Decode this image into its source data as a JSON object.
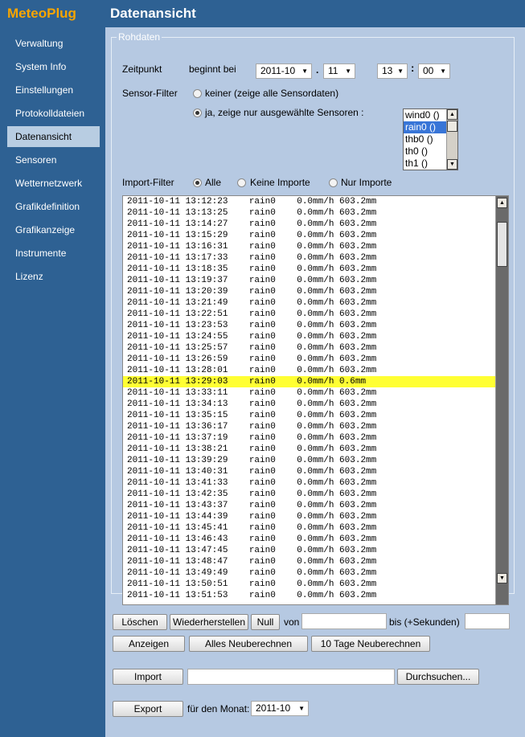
{
  "app": {
    "logo": "MeteoPlug",
    "page_title": "Datenansicht"
  },
  "sidebar": {
    "items": [
      {
        "label": "Verwaltung"
      },
      {
        "label": "System Info"
      },
      {
        "label": "Einstellungen"
      },
      {
        "label": "Protokolldateien"
      },
      {
        "label": "Datenansicht",
        "active": true
      },
      {
        "label": "Sensoren"
      },
      {
        "label": "Wetternetzwerk"
      },
      {
        "label": "Grafikdefinition"
      },
      {
        "label": "Grafikanzeige"
      },
      {
        "label": "Instrumente"
      },
      {
        "label": "Lizenz"
      }
    ]
  },
  "rohdaten": {
    "legend": "Rohdaten",
    "zeitpunkt": {
      "label": "Zeitpunkt",
      "begins_label": "beginnt bei",
      "month": "2011-10",
      "sep1": ".",
      "day": "11",
      "hour": "13",
      "sep2": ":",
      "minute": "00"
    },
    "sensor_filter": {
      "label": "Sensor-Filter",
      "option_none": "keiner (zeige alle Sensordaten)",
      "option_selected": "ja, zeige nur ausgewählte Sensoren :",
      "selected": "option_selected",
      "sensors": [
        "wind0 ()",
        "rain0 ()",
        "thb0 ()",
        "th0 ()",
        "th1 ()"
      ],
      "highlighted_sensor": "rain0 ()"
    },
    "import_filter": {
      "label": "Import-Filter",
      "options": [
        "Alle",
        "Keine Importe",
        "Nur Importe"
      ],
      "selected": "Alle"
    },
    "log_rows": [
      "2011-10-11 13:12:23    rain0    0.0mm/h 603.2mm",
      "2011-10-11 13:13:25    rain0    0.0mm/h 603.2mm",
      "2011-10-11 13:14:27    rain0    0.0mm/h 603.2mm",
      "2011-10-11 13:15:29    rain0    0.0mm/h 603.2mm",
      "2011-10-11 13:16:31    rain0    0.0mm/h 603.2mm",
      "2011-10-11 13:17:33    rain0    0.0mm/h 603.2mm",
      "2011-10-11 13:18:35    rain0    0.0mm/h 603.2mm",
      "2011-10-11 13:19:37    rain0    0.0mm/h 603.2mm",
      "2011-10-11 13:20:39    rain0    0.0mm/h 603.2mm",
      "2011-10-11 13:21:49    rain0    0.0mm/h 603.2mm",
      "2011-10-11 13:22:51    rain0    0.0mm/h 603.2mm",
      "2011-10-11 13:23:53    rain0    0.0mm/h 603.2mm",
      "2011-10-11 13:24:55    rain0    0.0mm/h 603.2mm",
      "2011-10-11 13:25:57    rain0    0.0mm/h 603.2mm",
      "2011-10-11 13:26:59    rain0    0.0mm/h 603.2mm",
      "2011-10-11 13:28:01    rain0    0.0mm/h 603.2mm",
      "2011-10-11 13:29:03    rain0    0.0mm/h 0.6mm",
      "2011-10-11 13:33:11    rain0    0.0mm/h 603.2mm",
      "2011-10-11 13:34:13    rain0    0.0mm/h 603.2mm",
      "2011-10-11 13:35:15    rain0    0.0mm/h 603.2mm",
      "2011-10-11 13:36:17    rain0    0.0mm/h 603.2mm",
      "2011-10-11 13:37:19    rain0    0.0mm/h 603.2mm",
      "2011-10-11 13:38:21    rain0    0.0mm/h 603.2mm",
      "2011-10-11 13:39:29    rain0    0.0mm/h 603.2mm",
      "2011-10-11 13:40:31    rain0    0.0mm/h 603.2mm",
      "2011-10-11 13:41:33    rain0    0.0mm/h 603.2mm",
      "2011-10-11 13:42:35    rain0    0.0mm/h 603.2mm",
      "2011-10-11 13:43:37    rain0    0.0mm/h 603.2mm",
      "2011-10-11 13:44:39    rain0    0.0mm/h 603.2mm",
      "2011-10-11 13:45:41    rain0    0.0mm/h 603.2mm",
      "2011-10-11 13:46:43    rain0    0.0mm/h 603.2mm",
      "2011-10-11 13:47:45    rain0    0.0mm/h 603.2mm",
      "2011-10-11 13:48:47    rain0    0.0mm/h 603.2mm",
      "2011-10-11 13:49:49    rain0    0.0mm/h 603.2mm",
      "2011-10-11 13:50:51    rain0    0.0mm/h 603.2mm",
      "2011-10-11 13:51:53    rain0    0.0mm/h 603.2mm"
    ],
    "highlighted_row": "2011-10-11 13:29:03    rain0    0.0mm/h 0.6mm",
    "highlight_color": "#ffff33"
  },
  "actions": {
    "loeschen": "Löschen",
    "wiederherstellen": "Wiederherstellen",
    "null": "Null",
    "von": "von",
    "bis": "bis (+Sekunden)",
    "anzeigen": "Anzeigen",
    "alles_neuberechnen": "Alles Neuberechnen",
    "tage_neuberechnen": "10 Tage Neuberechnen",
    "import": "Import",
    "durchsuchen": "Durchsuchen...",
    "export": "Export",
    "fuer_monat": "für den Monat:",
    "export_month": "2011-10"
  },
  "colors": {
    "sidebar": "#2e6193",
    "logo": "#f7a500",
    "content_bg": "#b6c9e2",
    "selection": "#3875d7"
  }
}
